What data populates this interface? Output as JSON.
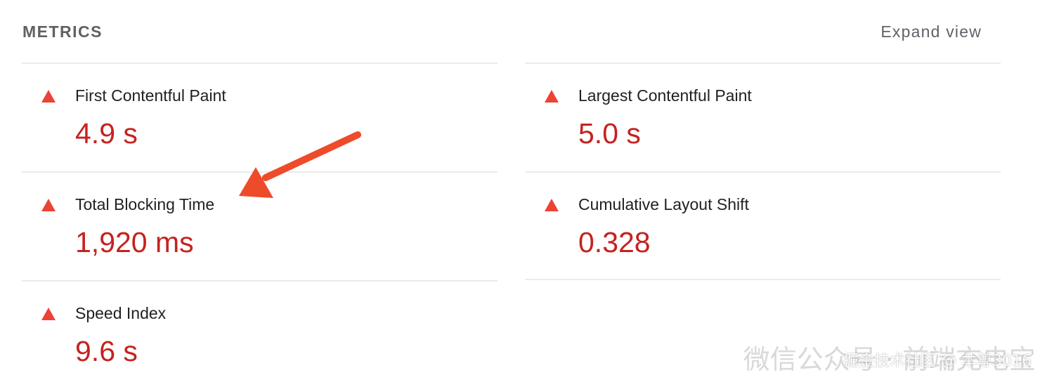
{
  "header": {
    "title": "METRICS",
    "expand_label": "Expand view"
  },
  "colors": {
    "fail": "#eb4335",
    "value": "#c5221f"
  },
  "metrics_left": [
    {
      "title": "First Contentful Paint",
      "value": "4.9 s",
      "status": "fail",
      "icon": "fail-triangle-icon"
    },
    {
      "title": "Total Blocking Time",
      "value": "1,920 ms",
      "status": "fail",
      "icon": "fail-triangle-icon"
    },
    {
      "title": "Speed Index",
      "value": "9.6 s",
      "status": "fail",
      "icon": "fail-triangle-icon"
    }
  ],
  "metrics_right": [
    {
      "title": "Largest Contentful Paint",
      "value": "5.0 s",
      "status": "fail",
      "icon": "fail-triangle-icon"
    },
    {
      "title": "Cumulative Layout Shift",
      "value": "0.328",
      "status": "fail",
      "icon": "fail-triangle-icon"
    }
  ],
  "watermark": {
    "text": "微信公众号 · 前端充电宝",
    "overlay_text": "掘金技术社区 @ 本尊3016"
  }
}
